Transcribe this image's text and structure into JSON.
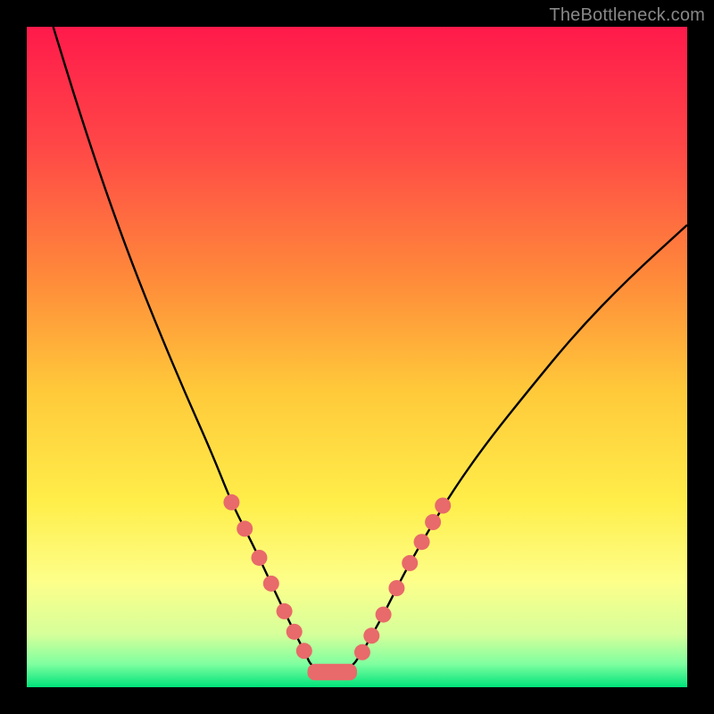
{
  "watermark": "TheBottleneck.com",
  "colors": {
    "frame_bg": "#000000",
    "gradient_stops": [
      {
        "offset": 0.0,
        "color": "#ff1a4b"
      },
      {
        "offset": 0.18,
        "color": "#ff4747"
      },
      {
        "offset": 0.38,
        "color": "#ff8a3a"
      },
      {
        "offset": 0.55,
        "color": "#ffc93a"
      },
      {
        "offset": 0.72,
        "color": "#ffee4a"
      },
      {
        "offset": 0.84,
        "color": "#fdff8a"
      },
      {
        "offset": 0.92,
        "color": "#d6ff9a"
      },
      {
        "offset": 0.965,
        "color": "#7fffa0"
      },
      {
        "offset": 1.0,
        "color": "#00e37a"
      }
    ],
    "curve_stroke": "#000000",
    "dot_fill": "#e86a6a",
    "bottom_band_fill": "#e86a6a"
  },
  "chart_data": {
    "type": "line",
    "title": "",
    "xlabel": "",
    "ylabel": "",
    "xlim": [
      0,
      100
    ],
    "ylim": [
      0,
      100
    ],
    "grid": false,
    "legend": false,
    "annotations": [],
    "series": [
      {
        "name": "bottleneck-curve",
        "x": [
          4,
          8,
          12,
          16,
          20,
          24,
          28,
          31,
          33,
          35,
          37,
          39,
          40.5,
          42,
          43.4,
          48.8,
          50.8,
          52.2,
          54,
          56,
          58,
          61,
          65,
          70,
          76,
          83,
          91,
          100
        ],
        "y": [
          100,
          87,
          75,
          64,
          54,
          44.5,
          35.5,
          28,
          24,
          20,
          15.7,
          11.5,
          8.4,
          5.5,
          2.5,
          2.5,
          5.3,
          7.8,
          11,
          15,
          18.8,
          24,
          30.5,
          37.5,
          45,
          53.5,
          61.8,
          70
        ]
      }
    ],
    "dots_left": [
      {
        "x": 31.0,
        "y": 28.0
      },
      {
        "x": 33.0,
        "y": 24.0
      },
      {
        "x": 35.2,
        "y": 19.6
      },
      {
        "x": 37.0,
        "y": 15.7
      },
      {
        "x": 39.0,
        "y": 11.5
      },
      {
        "x": 40.5,
        "y": 8.4
      },
      {
        "x": 42.0,
        "y": 5.5
      }
    ],
    "dots_right": [
      {
        "x": 50.8,
        "y": 5.3
      },
      {
        "x": 52.2,
        "y": 7.8
      },
      {
        "x": 54.0,
        "y": 11.0
      },
      {
        "x": 56.0,
        "y": 15.0
      },
      {
        "x": 58.0,
        "y": 18.8
      },
      {
        "x": 59.8,
        "y": 22.0
      },
      {
        "x": 61.5,
        "y": 25.0
      },
      {
        "x": 63.0,
        "y": 27.5
      }
    ],
    "bottom_band": {
      "x_start": 42.5,
      "x_end": 50.0,
      "y": 2.3,
      "thickness": 2.5
    }
  }
}
